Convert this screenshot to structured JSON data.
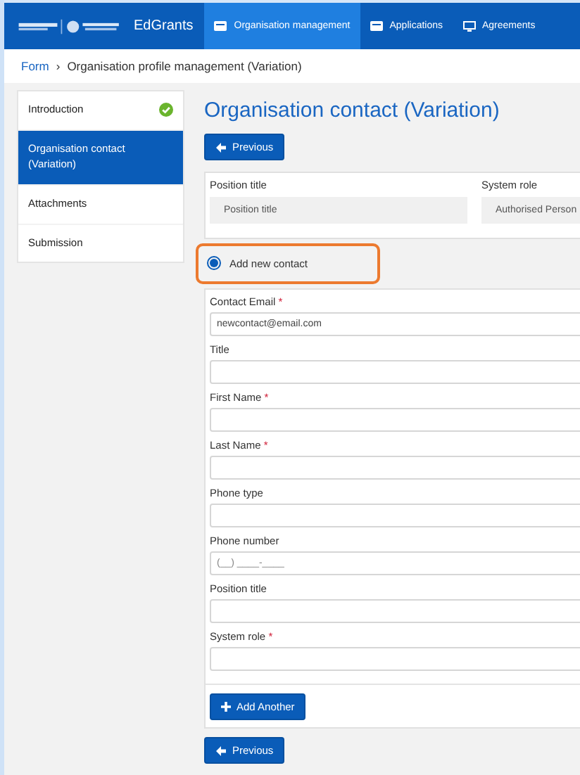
{
  "topbar": {
    "app_name": "EdGrants",
    "nav": [
      {
        "label": "Organisation management",
        "selected": true
      },
      {
        "label": "Applications",
        "selected": false
      },
      {
        "label": "Agreements",
        "selected": false
      }
    ]
  },
  "breadcrumb": {
    "link": "Form",
    "separator": "›",
    "current": "Organisation profile management (Variation)"
  },
  "sidebar": {
    "items": [
      {
        "label": "Introduction",
        "selected": false,
        "complete": true
      },
      {
        "label": "Organisation contact (Variation)",
        "selected": true,
        "complete": false
      },
      {
        "label": "Attachments",
        "selected": false,
        "complete": false
      },
      {
        "label": "Submission",
        "selected": false,
        "complete": false
      }
    ]
  },
  "page_title": "Organisation contact (Variation)",
  "previous_button": "Previous",
  "existing_contact": [
    {
      "label": "Position title",
      "value": "Position title"
    },
    {
      "label": "System role",
      "value": "Authorised Person"
    }
  ],
  "add_new_contact": {
    "label": "Add new contact",
    "selected": true
  },
  "fields": [
    {
      "label": "Contact Email",
      "required_mark": "*",
      "value": "newcontact@email.com"
    },
    {
      "label": "Title"
    },
    {
      "label": "First Name",
      "required_mark": "*"
    },
    {
      "label": "Last Name",
      "required_mark": "*"
    },
    {
      "label": "Phone type"
    },
    {
      "label": "Phone number",
      "placeholder": "(__) ____-____"
    },
    {
      "label": "Position title"
    },
    {
      "label": "System role",
      "required_mark": "*"
    }
  ],
  "add_another_button": "Add Another",
  "bottom_previous_button": "Previous"
}
